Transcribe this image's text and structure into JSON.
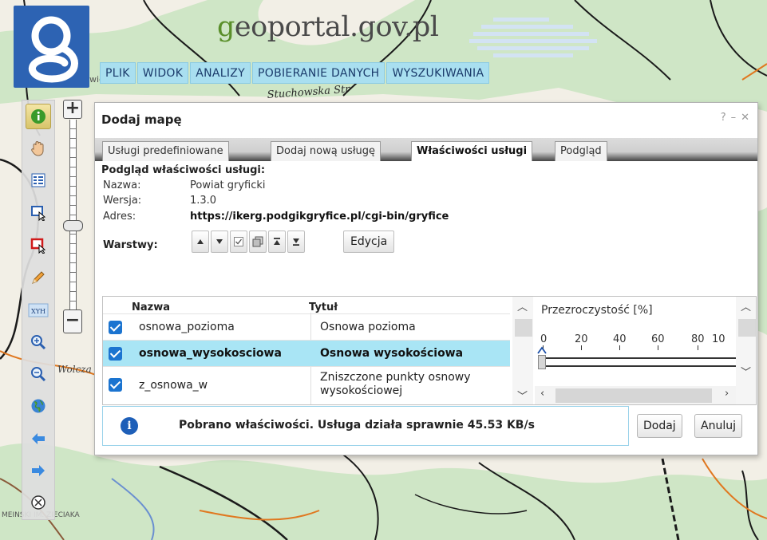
{
  "header": {
    "brand_prefix": "g",
    "brand_rest": "eoportal.gov.pl",
    "menu": [
      "PLIK",
      "WIDOK",
      "ANALIZY",
      "POBIERANIE DANYCH",
      "WYSZUKIWANIA"
    ]
  },
  "map_labels": {
    "street": "Stuchowska Str",
    "place1": "Świerz",
    "place2": "Wolcza",
    "place3": "MEINSKI IM. ZIECIAKA"
  },
  "toolbar": {
    "tools": [
      "info-icon",
      "pan-hand-icon",
      "legend-icon",
      "select-blue-icon",
      "select-red-icon",
      "edit-pencil-icon",
      "xyh-coords-icon",
      "zoom-in-icon",
      "zoom-out-icon",
      "globe-icon",
      "back-arrow-icon",
      "forward-arrow-icon",
      "close-circle-icon"
    ],
    "xyh_label": "XYH"
  },
  "zoom": {
    "plus": "+",
    "minus": "−"
  },
  "dialog": {
    "title": "Dodaj mapę",
    "controls": {
      "help": "?",
      "minimize": "–",
      "close": "✕"
    },
    "tabs": [
      "Usługi predefiniowane",
      "Dodaj nową usługę",
      "Właściwości usługi",
      "Podgląd"
    ],
    "active_tab": 2,
    "props_heading": "Podgląd właściwości usługi:",
    "name_key": "Nazwa:",
    "name_val": "Powiat gryficki",
    "version_key": "Wersja:",
    "version_val": "1.3.0",
    "address_key": "Adres:",
    "address_val": "https://ikerg.podgikgryfice.pl/cgi-bin/gryfice",
    "layers_label": "Warstwy:",
    "layer_buttons": [
      "move-up-icon",
      "move-down-icon",
      "check-icon",
      "copy-icon",
      "to-top-icon",
      "to-bottom-icon"
    ],
    "edit_label": "Edycja"
  },
  "grid": {
    "col_name": "Nazwa",
    "col_title": "Tytuł",
    "transparency_label": "Przezroczystość [%]",
    "ticks": [
      "0",
      "20",
      "40",
      "60",
      "80",
      "10"
    ],
    "rows": [
      {
        "name": "osnowa_pozioma",
        "title": "Osnowa pozioma",
        "checked": true,
        "selected": false
      },
      {
        "name": "osnowa_wysokosciowa",
        "title": "Osnowa wysokościowa",
        "checked": true,
        "selected": true
      },
      {
        "name": "z_osnowa_w",
        "title": "Zniszczone punkty osnowy wysokościowej",
        "checked": true,
        "selected": false
      }
    ],
    "transparency": 0
  },
  "status": {
    "icon": "info-icon",
    "text": "Pobrano właściwości. Usługa działa sprawnie 45.53 KB/s"
  },
  "buttons": {
    "add": "Dodaj",
    "cancel": "Anuluj"
  },
  "colors": {
    "accent": "#1e5fb8",
    "selected_row": "#a9e5f5",
    "menu_bg": "#a9dff0",
    "logo_bg": "#2d63b3"
  }
}
